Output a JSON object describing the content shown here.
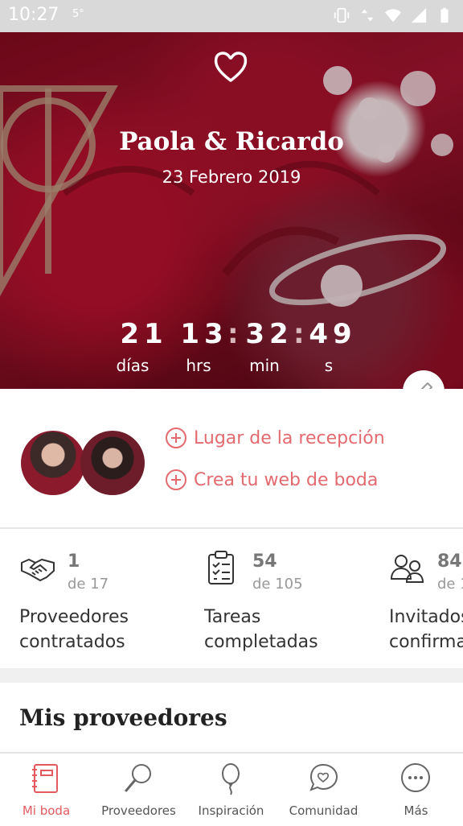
{
  "status_bar": {
    "time": "10:27",
    "extra": "5°"
  },
  "hero": {
    "couple": "Paola & Ricardo",
    "date": "23 Febrero 2019",
    "countdown": [
      {
        "value": "21",
        "unit": "días"
      },
      {
        "value": "13",
        "unit": "hrs"
      },
      {
        "value": "32",
        "unit": "min"
      },
      {
        "value": "49",
        "unit": "s"
      }
    ]
  },
  "profile": {
    "links": [
      {
        "label": "Lugar de la recepción",
        "icon": "plus-circle-icon"
      },
      {
        "label": "Crea tu web de boda",
        "icon": "plus-circle-icon"
      }
    ]
  },
  "stats": [
    {
      "icon": "handshake-icon",
      "count": "1",
      "of": "de 17",
      "label_line1": "Proveedores",
      "label_line2": "contratados"
    },
    {
      "icon": "clipboard-checklist-icon",
      "count": "54",
      "of": "de 105",
      "label_line1": "Tareas",
      "label_line2": "completadas"
    },
    {
      "icon": "guests-icon",
      "count": "84",
      "of": "de 1",
      "label_line1": "Invitados",
      "label_line2": "confirma"
    }
  ],
  "section": {
    "title": "Mis proveedores"
  },
  "bottom_nav": [
    {
      "label": "Mi boda",
      "icon": "notebook-icon",
      "active": true
    },
    {
      "label": "Proveedores",
      "icon": "magnifier-icon",
      "active": false
    },
    {
      "label": "Inspiración",
      "icon": "balloon-icon",
      "active": false
    },
    {
      "label": "Comunidad",
      "icon": "chat-heart-icon",
      "active": false
    },
    {
      "label": "Más",
      "icon": "more-dots-icon",
      "active": false
    }
  ],
  "colors": {
    "accent": "#e35a5f",
    "link": "#e36a6f",
    "hero_base": "#9d1630"
  }
}
